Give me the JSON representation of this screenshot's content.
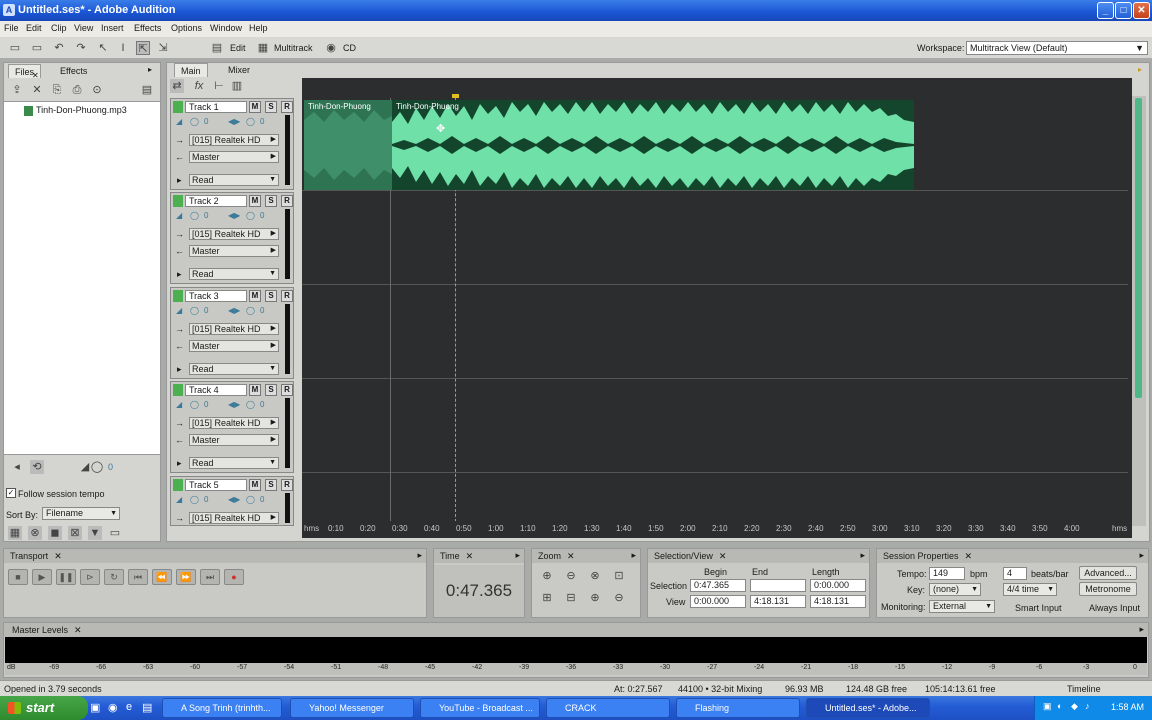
{
  "window": {
    "title": "Untitled.ses* - Adobe Audition"
  },
  "menu": [
    "File",
    "Edit",
    "Clip",
    "View",
    "Insert",
    "Effects",
    "Options",
    "Window",
    "Help"
  ],
  "toolbar": {
    "edit_label": "Edit",
    "multitrack_label": "Multitrack",
    "cd_label": "CD",
    "workspace_label": "Workspace:",
    "workspace_value": "Multitrack View (Default)"
  },
  "left_panel": {
    "tabs": [
      "Files",
      "Effects"
    ],
    "file_item": "Tinh-Don-Phuong.mp3",
    "follow_label": "Follow session tempo",
    "sort_label": "Sort By:",
    "sort_value": "Filename",
    "volume_value": "0"
  },
  "main_tabs": [
    "Main",
    "Mixer"
  ],
  "tracks": [
    {
      "name": "Track 1",
      "vol": "0",
      "pan": "0",
      "input": "[015] Realtek HD",
      "output": "Master",
      "mode": "Read"
    },
    {
      "name": "Track 2",
      "vol": "0",
      "pan": "0",
      "input": "[015] Realtek HD",
      "output": "Master",
      "mode": "Read"
    },
    {
      "name": "Track 3",
      "vol": "0",
      "pan": "0",
      "input": "[015] Realtek HD",
      "output": "Master",
      "mode": "Read"
    },
    {
      "name": "Track 4",
      "vol": "0",
      "pan": "0",
      "input": "[015] Realtek HD",
      "output": "Master",
      "mode": "Read"
    },
    {
      "name": "Track 5",
      "vol": "0",
      "pan": "0",
      "input": "[015] Realtek HD",
      "output": "",
      "mode": ""
    }
  ],
  "clip": {
    "label_a": "Tinh-Don-Phuong",
    "label_b": "Tinh-Don-Phuong"
  },
  "ruler": {
    "ticks": [
      "hms",
      "0:10",
      "0:20",
      "0:30",
      "0:40",
      "0:50",
      "1:00",
      "1:10",
      "1:20",
      "1:30",
      "1:40",
      "1:50",
      "2:00",
      "2:10",
      "2:20",
      "2:30",
      "2:40",
      "2:50",
      "3:00",
      "3:10",
      "3:20",
      "3:30",
      "3:40",
      "3:50",
      "4:00",
      "hms"
    ]
  },
  "transport": {
    "title": "Transport"
  },
  "time": {
    "title": "Time",
    "value": "0:47.365"
  },
  "zoom": {
    "title": "Zoom"
  },
  "selection": {
    "title": "Selection/View",
    "col_begin": "Begin",
    "col_end": "End",
    "col_length": "Length",
    "row_selection": "Selection",
    "row_view": "View",
    "sel_begin": "0:47.365",
    "sel_end": "",
    "sel_length": "0:00.000",
    "view_begin": "0:00.000",
    "view_end": "4:18.131",
    "view_length": "4:18.131"
  },
  "session": {
    "title": "Session Properties",
    "tempo_label": "Tempo:",
    "tempo_value": "149",
    "bpm_label": "bpm",
    "beats_value": "4",
    "beats_label": "beats/bar",
    "advanced_label": "Advanced...",
    "key_label": "Key:",
    "key_value": "(none)",
    "time_sig": "4/4 time",
    "metronome_label": "Metronome",
    "monitoring_label": "Monitoring:",
    "monitoring_value": "External",
    "smart_input": "Smart Input",
    "always_input": "Always Input"
  },
  "levels": {
    "title": "Master Levels",
    "scale": [
      "dB",
      "-69",
      "-66",
      "-63",
      "-60",
      "-57",
      "-54",
      "-51",
      "-48",
      "-45",
      "-42",
      "-39",
      "-36",
      "-33",
      "-30",
      "-27",
      "-24",
      "-21",
      "-18",
      "-15",
      "-12",
      "-9",
      "-6",
      "-3",
      "0"
    ]
  },
  "status": {
    "left": "Opened in 3.79 seconds",
    "at": "At:  0:27.567",
    "format": "44100 • 32-bit Mixing",
    "mem": "96.93 MB",
    "disk": "124.48 GB free",
    "time_free": "105:14:13.61 free",
    "view": "Timeline"
  },
  "taskbar": {
    "start": "start",
    "items": [
      "A Song Trinh (trinhth...",
      "Yahoo! Messenger",
      "YouTube - Broadcast ...",
      "CRACK",
      "Flashing",
      "Untitled.ses* - Adobe..."
    ],
    "clock": "1:58 AM"
  },
  "colors": {
    "waveform": "#6fe0a8",
    "waveform_dark": "#0f3d27",
    "timeline_bg": "#2b2d2e",
    "titlebar": "#1a55d4"
  }
}
